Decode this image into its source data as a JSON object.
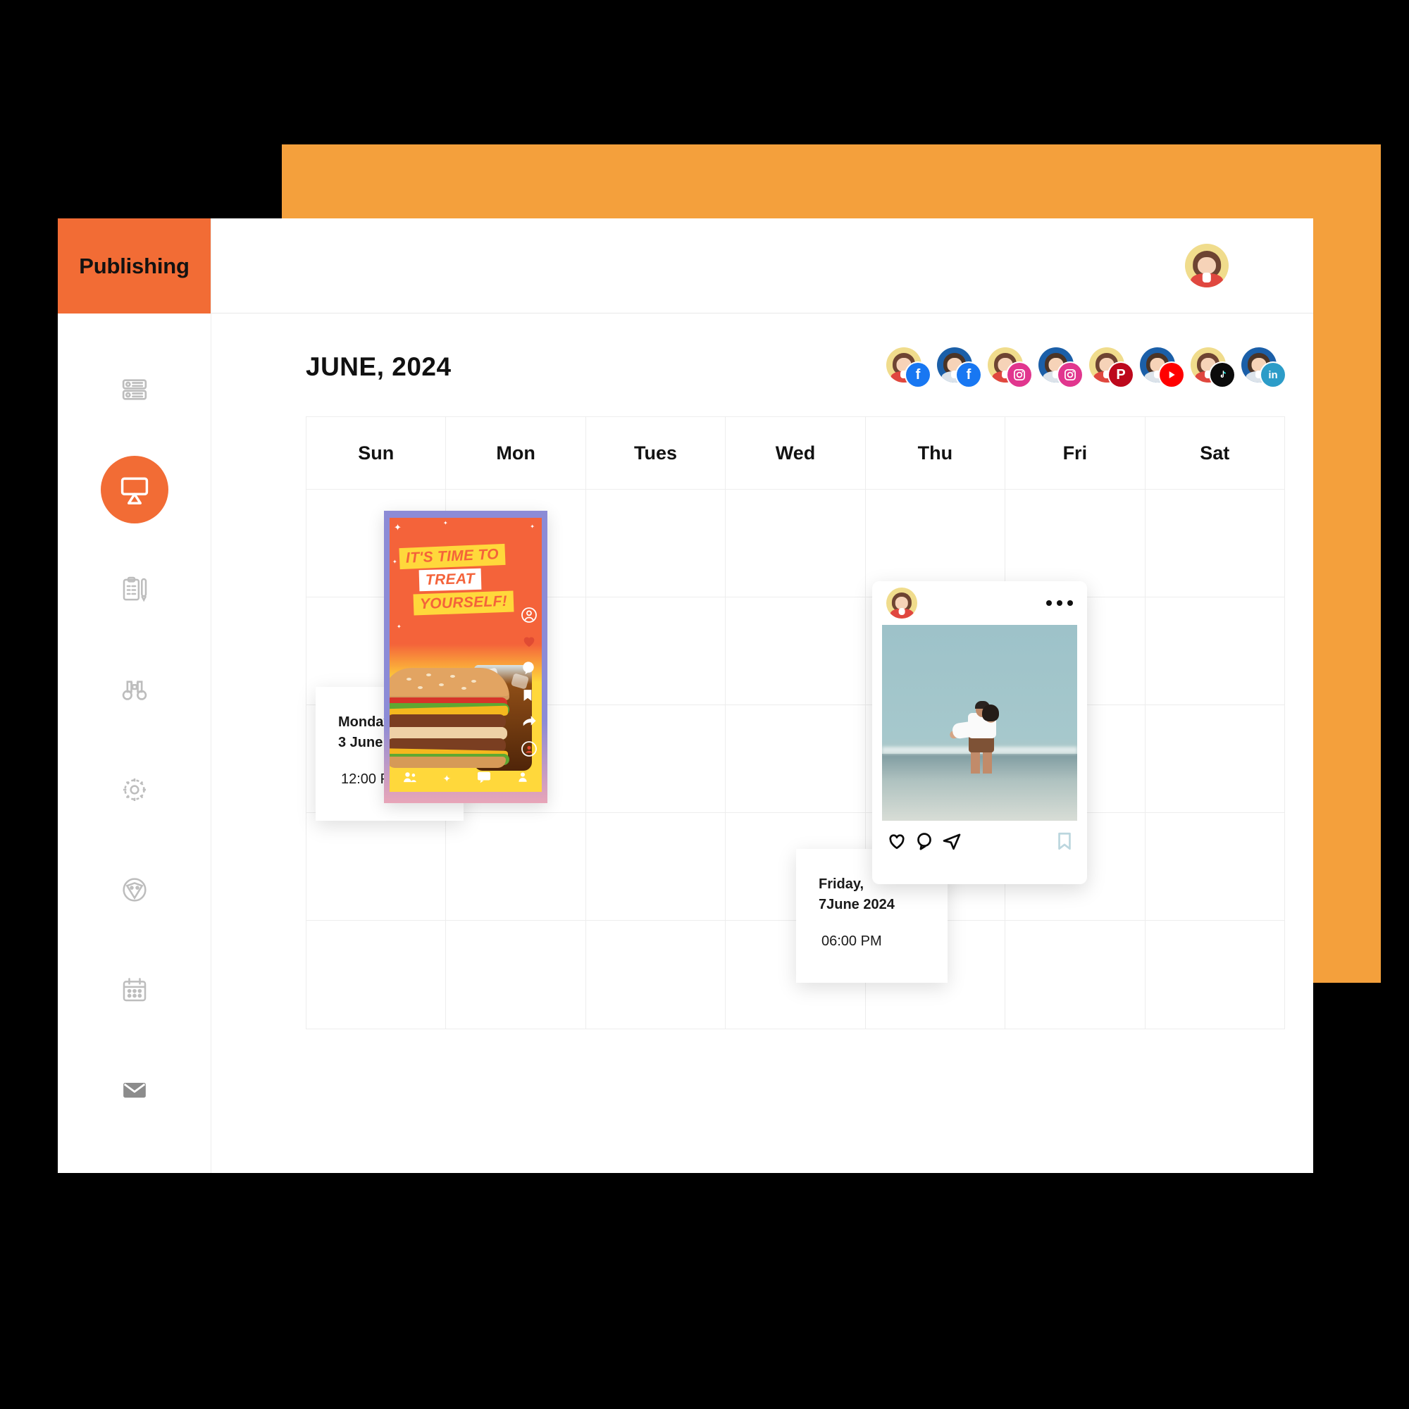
{
  "brand": {
    "title": "Publishing"
  },
  "theme": {
    "orange": "#F26C35",
    "orange_backdrop": "#F4A03C",
    "creative_orange": "#F4633A",
    "creative_yellow": "#FFD83B"
  },
  "topbar": {
    "avatar_name": "user-avatar"
  },
  "header": {
    "month_title": "JUNE, 2024"
  },
  "sidebar": {
    "items": [
      {
        "icon": "server-list-icon",
        "name": "sidebar-item-accounts",
        "active": false
      },
      {
        "icon": "presentation-icon",
        "name": "sidebar-item-publishing",
        "active": true
      },
      {
        "icon": "clipboard-pen-icon",
        "name": "sidebar-item-tasks",
        "active": false
      },
      {
        "icon": "binoculars-icon",
        "name": "sidebar-item-monitoring",
        "active": false
      },
      {
        "icon": "gear-icon",
        "name": "sidebar-item-settings",
        "active": false
      },
      {
        "icon": "shield-badge-icon",
        "name": "sidebar-item-security",
        "active": false
      },
      {
        "icon": "calendar-icon",
        "name": "sidebar-item-calendar",
        "active": false
      },
      {
        "icon": "envelope-icon",
        "name": "sidebar-item-inbox",
        "active": false
      },
      {
        "icon": "open-envelope-icon",
        "name": "sidebar-item-messages",
        "active": false
      }
    ]
  },
  "social_accounts": [
    {
      "network": "facebook",
      "badge_icon": "facebook-icon",
      "glyph": "f",
      "avatar": "female"
    },
    {
      "network": "facebook",
      "badge_icon": "facebook-icon",
      "glyph": "f",
      "avatar": "male"
    },
    {
      "network": "instagram",
      "badge_icon": "instagram-icon",
      "glyph": "",
      "avatar": "female"
    },
    {
      "network": "instagram",
      "badge_icon": "instagram-icon",
      "glyph": "",
      "avatar": "male"
    },
    {
      "network": "pinterest",
      "badge_icon": "pinterest-icon",
      "glyph": "P",
      "avatar": "female"
    },
    {
      "network": "youtube",
      "badge_icon": "youtube-icon",
      "glyph": "",
      "avatar": "male"
    },
    {
      "network": "tiktok",
      "badge_icon": "tiktok-icon",
      "glyph": "",
      "avatar": "female"
    },
    {
      "network": "linkedin",
      "badge_icon": "linkedin-icon",
      "glyph": "in",
      "avatar": "male"
    }
  ],
  "calendar": {
    "day_headers": [
      "Sun",
      "Mon",
      "Tues",
      "Wed",
      "Thu",
      "Fri",
      "Sat"
    ],
    "week_rows": 5,
    "columns": 7
  },
  "posts": [
    {
      "id": "burger-post",
      "date_label_day": "Monday,",
      "date_label_date": "3 June 2024",
      "time": "12:00 PM",
      "creative": {
        "headline_line1": "IT'S TIME TO",
        "headline_line2": "TREAT",
        "headline_line3": "YOURSELF!",
        "subject": "burger-and-cola"
      }
    },
    {
      "id": "beach-post",
      "date_label_day": "Friday,",
      "date_label_date": "7June 2024",
      "time": "06:00 PM",
      "creative": {
        "subject": "couple-on-beach",
        "actions": [
          "heart-icon",
          "comment-icon",
          "share-icon",
          "bookmark-icon"
        ],
        "menu": "more-options-icon"
      }
    }
  ]
}
